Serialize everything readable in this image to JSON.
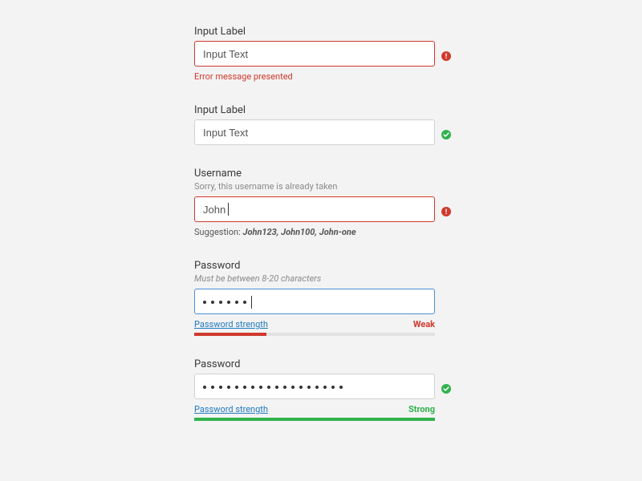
{
  "fields": {
    "error_field": {
      "label": "Input Label",
      "value": "Input Text",
      "error_message": "Error message presented"
    },
    "success_field": {
      "label": "Input Label",
      "value": "Input Text"
    },
    "username_field": {
      "label": "Username",
      "sublabel": "Sorry, this username is already taken",
      "value": "John",
      "suggestion_prefix": "Suggestion: ",
      "suggestion_values": "John123, John100, John-one"
    },
    "password_weak": {
      "label": "Password",
      "sublabel": "Must be between 8-20 characters",
      "dot_count": 6,
      "strength_link": "Password strength",
      "strength_label": "Weak",
      "strength_percent": 30
    },
    "password_strong": {
      "label": "Password",
      "dot_count": 18,
      "strength_link": "Password strength",
      "strength_label": "Strong",
      "strength_percent": 100
    }
  },
  "colors": {
    "error": "#d0392e",
    "success": "#2fb24c",
    "link": "#1f7abf",
    "focus": "#4a90d9"
  }
}
